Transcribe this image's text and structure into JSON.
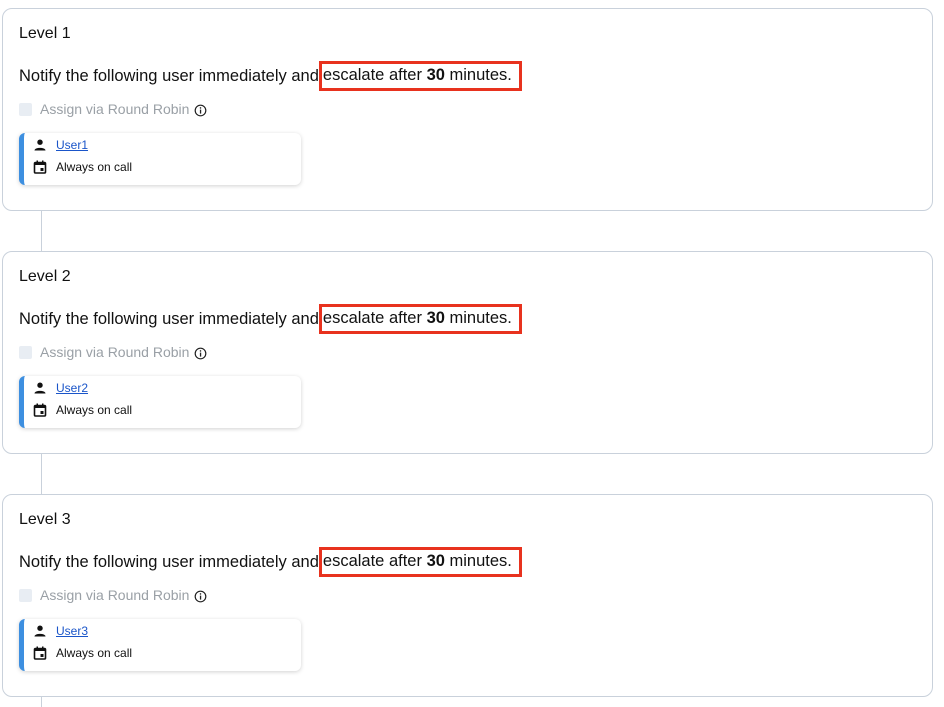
{
  "colors": {
    "border": "#c9d1db",
    "highlight": "#e8321e",
    "accent": "#3d8fe0",
    "link": "#1a55c9",
    "muted": "#9aa0a6"
  },
  "levels": [
    {
      "title": "Level 1",
      "notify_text": "Notify the following user immediately and",
      "escalate_prefix": "escalate after",
      "escalate_minutes": "30",
      "escalate_suffix": "minutes.",
      "round_robin_label": "Assign via Round Robin",
      "round_robin_checked": false,
      "user": {
        "name": "User1",
        "icon": "person-icon",
        "schedule": "Always on call",
        "schedule_icon": "calendar-icon"
      }
    },
    {
      "title": "Level 2",
      "notify_text": "Notify the following user immediately and",
      "escalate_prefix": "escalate after",
      "escalate_minutes": "30",
      "escalate_suffix": "minutes.",
      "round_robin_label": "Assign via Round Robin",
      "round_robin_checked": false,
      "user": {
        "name": "User2",
        "icon": "person-icon",
        "schedule": "Always on call",
        "schedule_icon": "calendar-icon"
      }
    },
    {
      "title": "Level 3",
      "notify_text": "Notify the following user immediately and",
      "escalate_prefix": "escalate after",
      "escalate_minutes": "30",
      "escalate_suffix": "minutes.",
      "round_robin_label": "Assign via Round Robin",
      "round_robin_checked": false,
      "user": {
        "name": "User3",
        "icon": "person-icon",
        "schedule": "Always on call",
        "schedule_icon": "calendar-icon"
      }
    }
  ]
}
